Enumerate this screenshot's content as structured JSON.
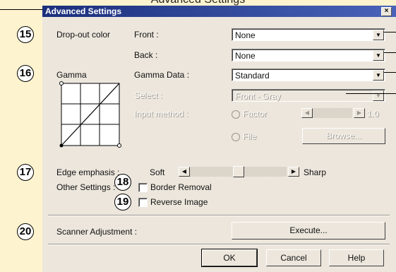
{
  "heading": "Advanced Settings",
  "dialog": {
    "title": "Advanced Settings",
    "close": "×",
    "callouts": [
      "15",
      "16",
      "17",
      "18",
      "19",
      "20"
    ],
    "dropout": {
      "label": "Drop-out color",
      "front_label": "Front :",
      "front_value": "None",
      "back_label": "Back :",
      "back_value": "None"
    },
    "gamma": {
      "label": "Gamma",
      "data_label": "Gamma Data :",
      "data_value": "Standard",
      "select_label": "Select :",
      "select_value": "Front - Gray",
      "input_method_label": "Input method :",
      "factor_label": "Factor",
      "factor_value": "1.0",
      "file_label": "File",
      "browse_label": "Browse..."
    },
    "edge": {
      "label": "Edge emphasis :",
      "soft": "Soft",
      "sharp": "Sharp",
      "level": 0.5
    },
    "other": {
      "label": "Other Settings :",
      "border_removal": "Border Removal",
      "reverse_image": "Reverse Image"
    },
    "scanner": {
      "label": "Scanner Adjustment :",
      "execute": "Execute..."
    },
    "buttons": {
      "ok": "OK",
      "cancel": "Cancel",
      "help": "Help"
    }
  }
}
